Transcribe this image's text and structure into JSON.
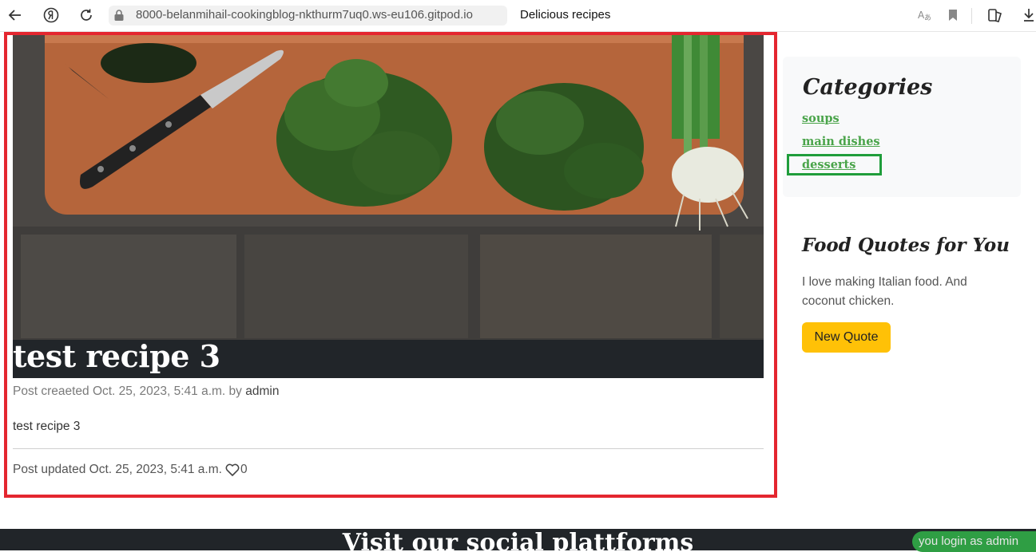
{
  "browser": {
    "url": "8000-belanmihail-cookingblog-nkthurm7uq0.ws-eu106.gitpod.io",
    "tab_title": "Delicious recipes",
    "icons": [
      "back-icon",
      "yandex-icon",
      "reload-icon",
      "lock-icon",
      "translate-icon",
      "bookmark-icon",
      "collections-icon",
      "download-icon"
    ]
  },
  "post": {
    "title": "test recipe 3",
    "meta_prefix": "Post creaeted Oct. 25, 2023, 5:41 a.m. by ",
    "author": "admin",
    "body": "test recipe 3",
    "updated": "Post updated Oct. 25, 2023, 5:41 a.m.",
    "like_count": "0",
    "image_alt": "Cutting board with knife, spinach and green onions"
  },
  "sidebar": {
    "categories_heading": "Categories",
    "categories": [
      {
        "label": "soups"
      },
      {
        "label": "main dishes"
      },
      {
        "label": "desserts"
      }
    ],
    "quotes_heading": "Food Quotes for You",
    "quote_text": "I love making Italian food. And coconut chicken.",
    "new_quote_label": "New Quote"
  },
  "footer": {
    "title": "Visit our social plattforms",
    "login_status": "you login as admin"
  },
  "colors": {
    "highlight_red": "#e4262f",
    "highlight_green": "#1f9d3b",
    "link_green": "#4aa44a",
    "button_yellow": "#ffc107",
    "dark_bar": "#212529"
  }
}
